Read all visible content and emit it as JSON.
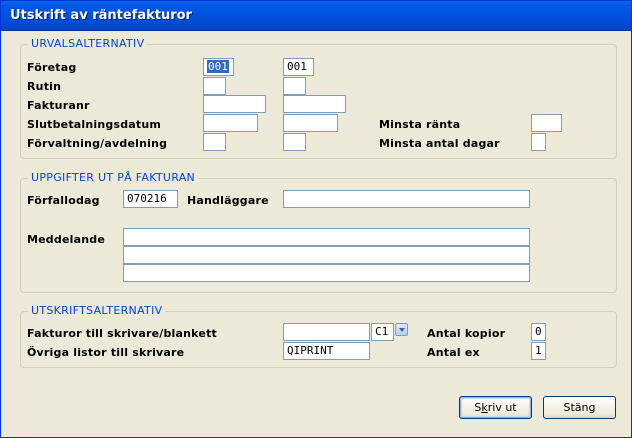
{
  "window": {
    "title": "Utskrift av räntefakturor"
  },
  "urval": {
    "legend": "URVALSALTERNATIV",
    "foretag_label": "Företag",
    "foretag_from": "001",
    "foretag_to": "001",
    "rutin_label": "Rutin",
    "fakturanr_label": "Fakturanr",
    "slutbetalningsdatum_label": "Slutbetalningsdatum",
    "forvaltning_label": "Förvaltning/avdelning",
    "minsta_ranta_label": "Minsta ränta",
    "minsta_antal_dagar_label": "Minsta antal dagar"
  },
  "uppgifter": {
    "legend": "UPPGIFTER UT PÅ FAKTURAN",
    "forfallodag_label": "Förfallodag",
    "forfallodag_value": "070216",
    "handlaggare_label": "Handläggare",
    "meddelande_label": "Meddelande"
  },
  "utskrift": {
    "legend": "UTSKRIFTSALTERNATIV",
    "fakturor_label": "Fakturor till skrivare/blankett",
    "fakturor_code": "C1",
    "ovriga_label": "Övriga listor till skrivare",
    "ovriga_value": "QIPRINT",
    "antal_kopior_label": "Antal kopior",
    "antal_kopior_value": "0",
    "antal_ex_label": "Antal ex",
    "antal_ex_value": "1"
  },
  "buttons": {
    "skriv_ut_first": "S",
    "skriv_ut_mnemonic": "k",
    "skriv_ut_rest": "riv ut",
    "stang_label": "Stäng"
  }
}
